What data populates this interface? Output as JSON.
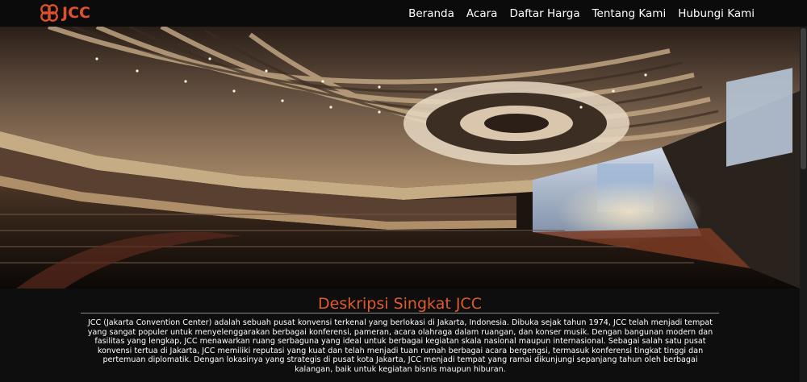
{
  "navbar": {
    "brand": "JCC",
    "brand_color": "#e0502a",
    "links": [
      "Beranda",
      "Acara",
      "Daftar Harga",
      "Tentang Kami",
      "Hubungi Kami"
    ]
  },
  "hero": {
    "icon": "convention-hall-photo"
  },
  "description": {
    "title": "Deskripsi Singkat JCC",
    "title_color": "#e05a2c",
    "text": "JCC (Jakarta Convention Center) adalah sebuah pusat konvensi terkenal yang berlokasi di Jakarta, Indonesia. Dibuka sejak tahun 1974, JCC telah menjadi tempat yang sangat populer untuk menyelenggarakan berbagai konferensi, pameran, acara olahraga dalam ruangan, dan konser musik. Dengan bangunan modern dan fasilitas yang lengkap, JCC menawarkan ruang serbaguna yang ideal untuk berbagai kegiatan skala nasional maupun internasional. Sebagai salah satu pusat konvensi tertua di Jakarta, JCC memiliki reputasi yang kuat dan telah menjadi tuan rumah berbagai acara bergengsi, termasuk konferensi tingkat tinggi dan pertemuan diplomatik. Dengan lokasinya yang strategis di pusat kota Jakarta, JCC menjadi tempat yang ramai dikunjungi sepanjang tahun oleh berbagai kalangan, baik untuk kegiatan bisnis maupun hiburan."
  }
}
